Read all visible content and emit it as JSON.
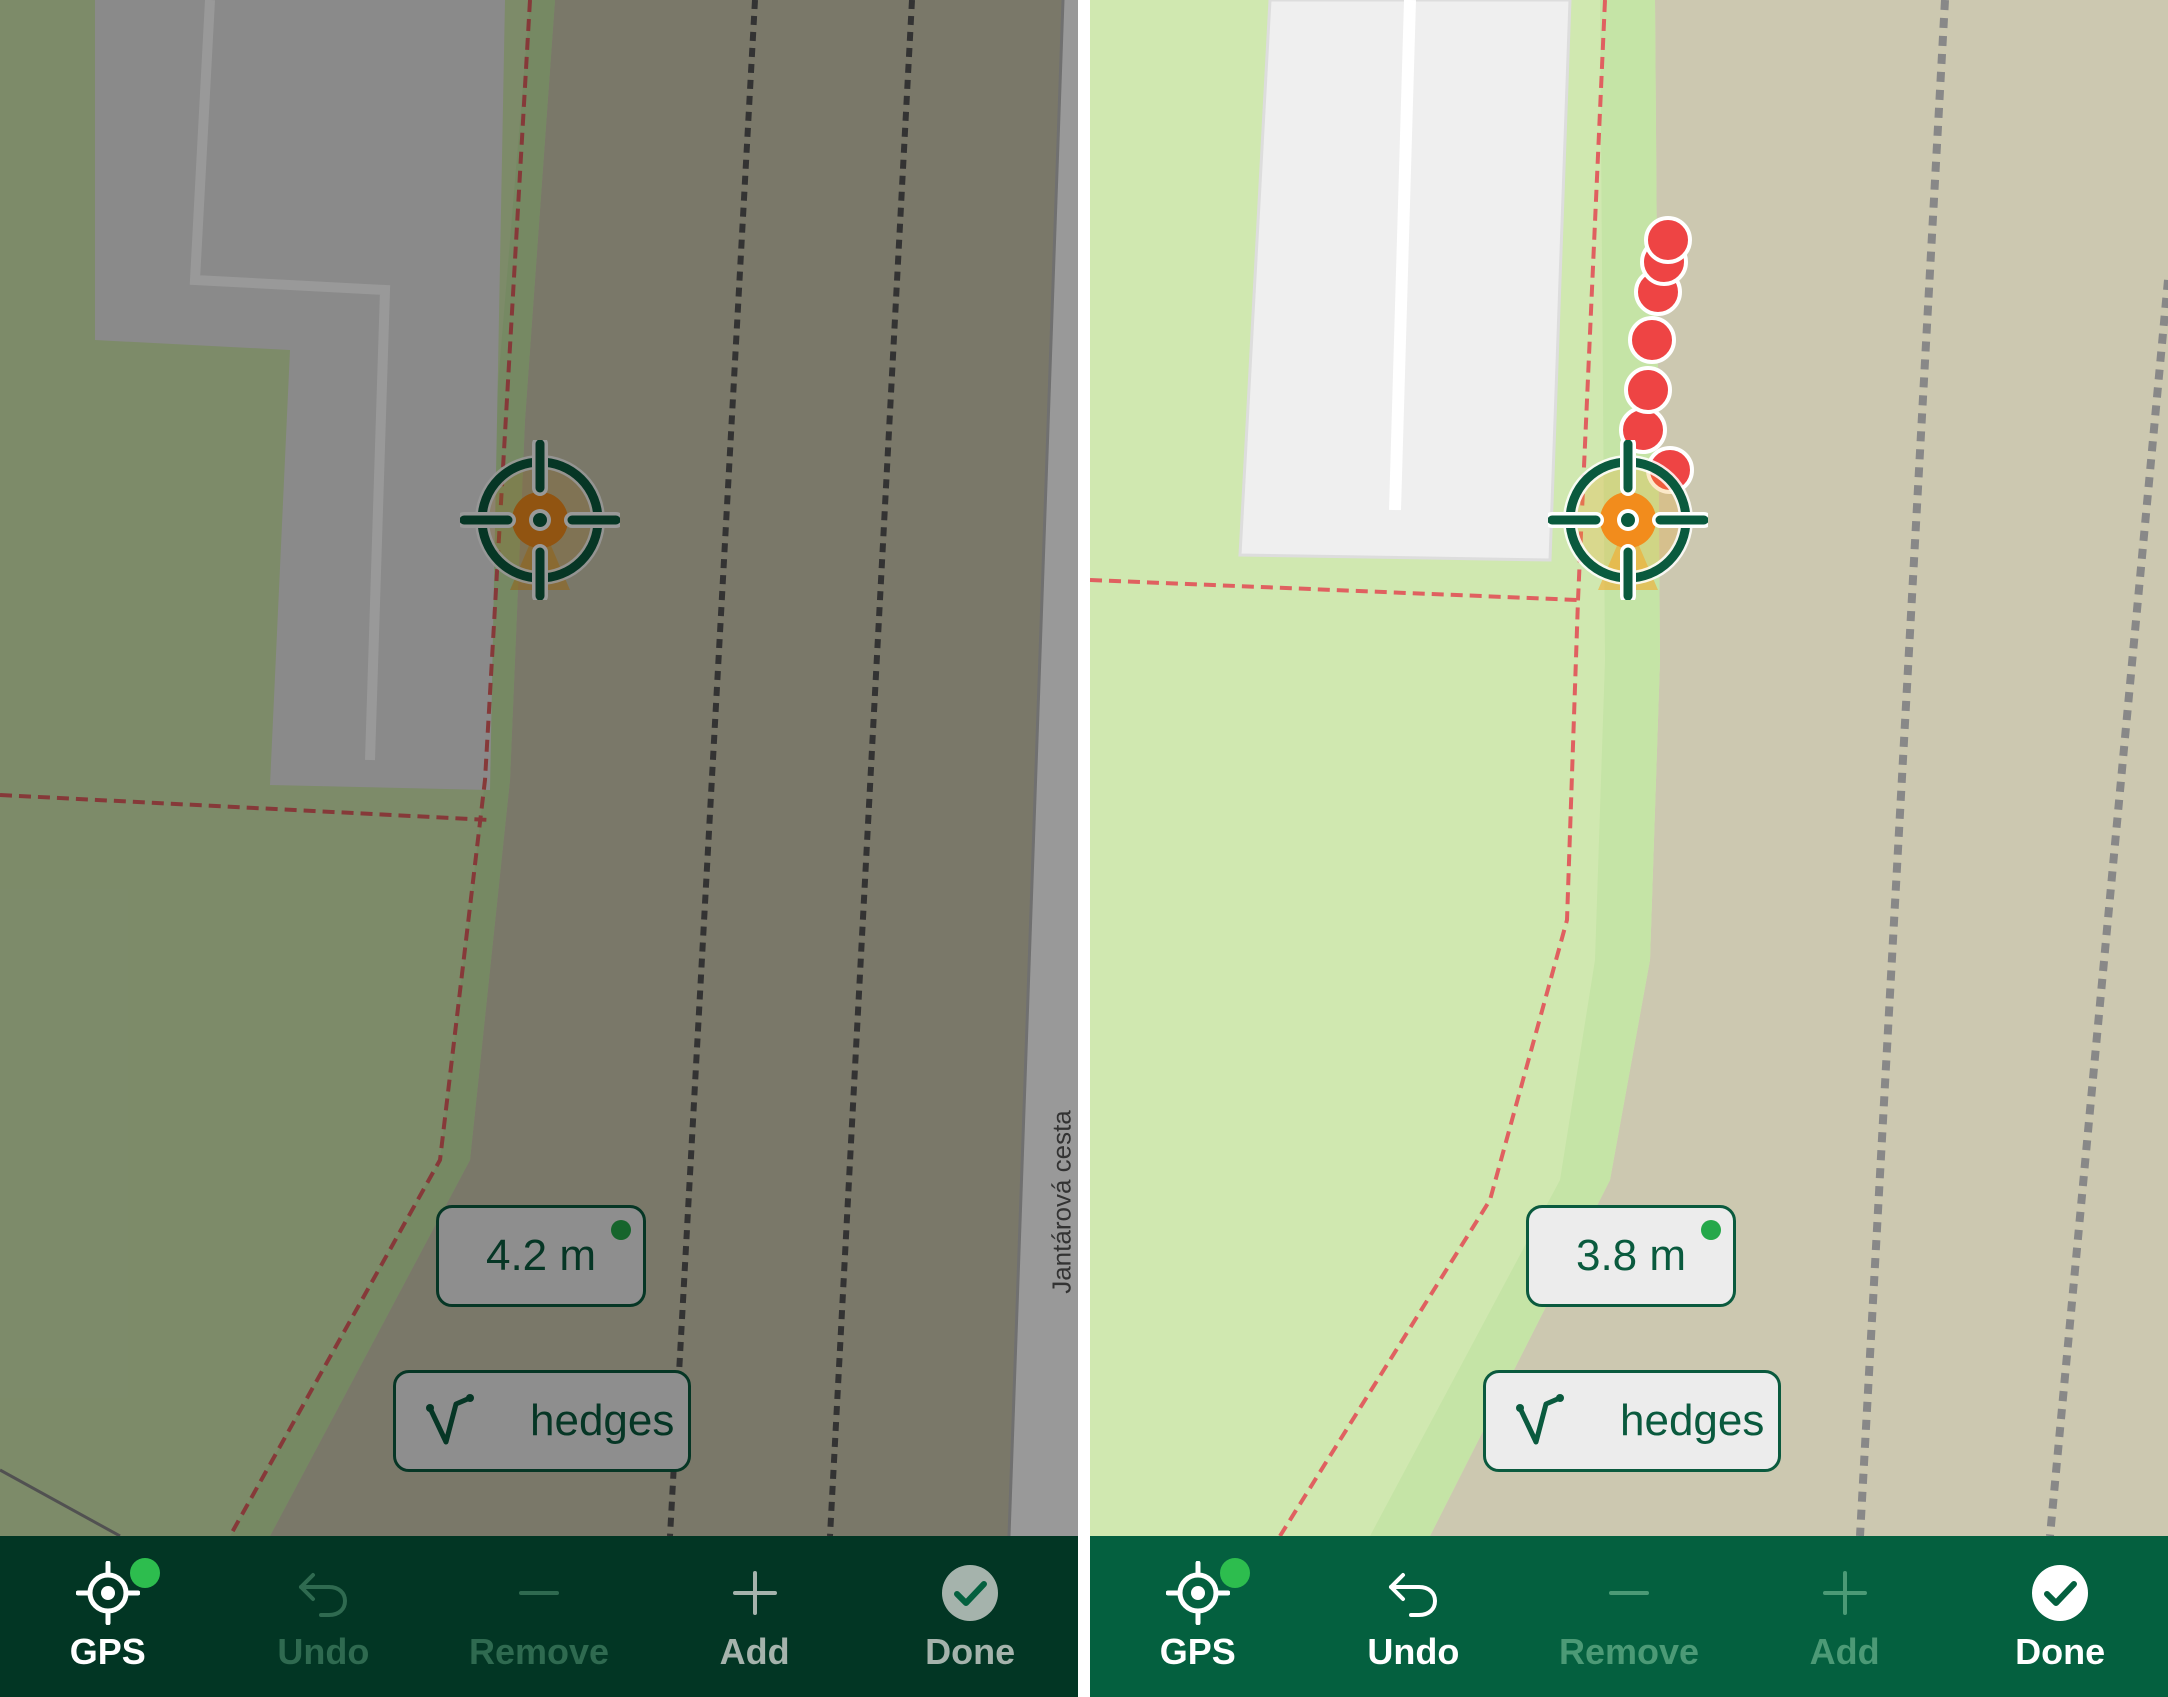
{
  "panels": [
    {
      "id": "left",
      "state": "dimmed",
      "accuracy": "4.2 m",
      "accuracy_status_color": "#25a84a",
      "layer": {
        "label": "hedges",
        "icon": "polyline-icon"
      },
      "street_label": "Jantárová cesta",
      "toolbar": [
        {
          "label": "GPS",
          "icon": "gps-target-icon",
          "enabled": true,
          "highlighted": true,
          "status_dot": true
        },
        {
          "label": "Undo",
          "icon": "undo-icon",
          "enabled": false
        },
        {
          "label": "Remove",
          "icon": "minus-icon",
          "enabled": false
        },
        {
          "label": "Add",
          "icon": "plus-icon",
          "enabled": true
        },
        {
          "label": "Done",
          "icon": "check-circle-icon",
          "enabled": true
        }
      ]
    },
    {
      "id": "right",
      "state": "normal",
      "accuracy": "3.8 m",
      "accuracy_status_color": "#25a84a",
      "layer": {
        "label": "hedges",
        "icon": "polyline-icon"
      },
      "recorded_points": 7,
      "toolbar": [
        {
          "label": "GPS",
          "icon": "gps-target-icon",
          "enabled": true,
          "status_dot": true
        },
        {
          "label": "Undo",
          "icon": "undo-icon",
          "enabled": true
        },
        {
          "label": "Remove",
          "icon": "minus-icon",
          "enabled": false
        },
        {
          "label": "Add",
          "icon": "plus-icon",
          "enabled": false
        },
        {
          "label": "Done",
          "icon": "check-circle-icon",
          "enabled": true
        }
      ]
    }
  ],
  "colors": {
    "toolbar": "#04603f",
    "accent": "#0a5a3e",
    "point": "#ee4444",
    "gps_status": "#2dbd4e",
    "highlight": "#f01818"
  }
}
